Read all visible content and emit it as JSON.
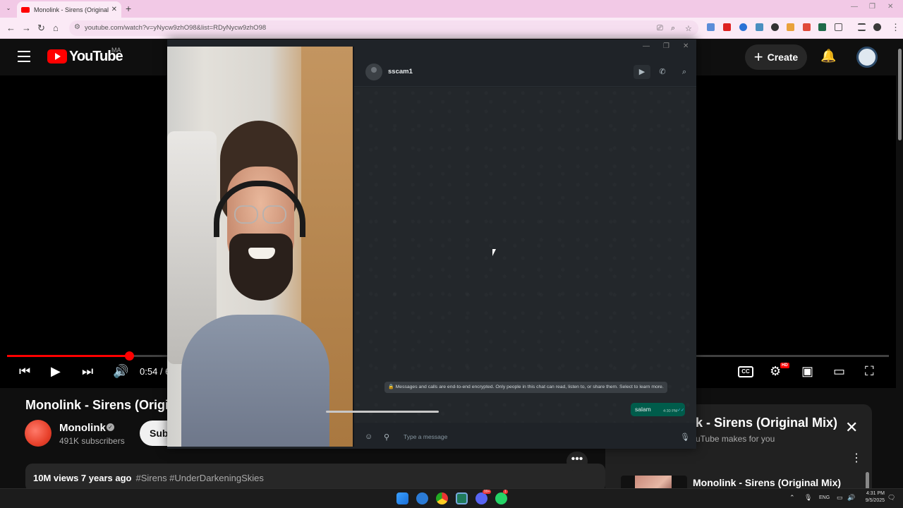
{
  "browser": {
    "tab_title": "Monolink - Sirens (Original Mix",
    "tab_close": "✕",
    "new_tab": "+",
    "url": "youtube.com/watch?v=yNycw9zhO98&list=RDyNycw9zhO98"
  },
  "youtube": {
    "logo_text": "YouTube",
    "country_code": "MA",
    "create_label": "Create",
    "player": {
      "time": "0:54 / 6",
      "cc_label": "CC",
      "hd_badge": "HD",
      "progress_fraction": 0.138
    },
    "video": {
      "title": "Monolink - Sirens (Origi",
      "channel": "Monolink",
      "verified": "✓",
      "subscribers": "491K subscribers",
      "subscribe_label": "Sub",
      "views_date": "10M views  7 years ago",
      "hashtags": "#Sirens #UnderDarkeningSkies",
      "more": "•••"
    },
    "mix_panel": {
      "title": "k - Sirens (Original Mix)",
      "subtitle": "uTube makes for you",
      "item_title": "Monolink - Sirens (Original Mix)"
    }
  },
  "whatsapp": {
    "contact_name": "sscam1",
    "encryption_notice": "🔒 Messages and calls are end-to-end encrypted. Only people in this chat can read, listen to, or share them. Select to learn more.",
    "messages": [
      {
        "text": "salam",
        "time": "4:30 PM",
        "status": "✓✓",
        "outgoing": true
      }
    ],
    "compose_placeholder": "Type a message"
  },
  "taskbar": {
    "language": "ENG",
    "clock_time": "4:31 PM",
    "clock_date": "9/5/2025",
    "discord_badge": "99+",
    "whatsapp_badge": "1"
  },
  "colors": {
    "youtube_red": "#ff0000",
    "whatsapp_bubble": "#005c4b",
    "chrome_tabstrip": "#f2c9e6"
  }
}
